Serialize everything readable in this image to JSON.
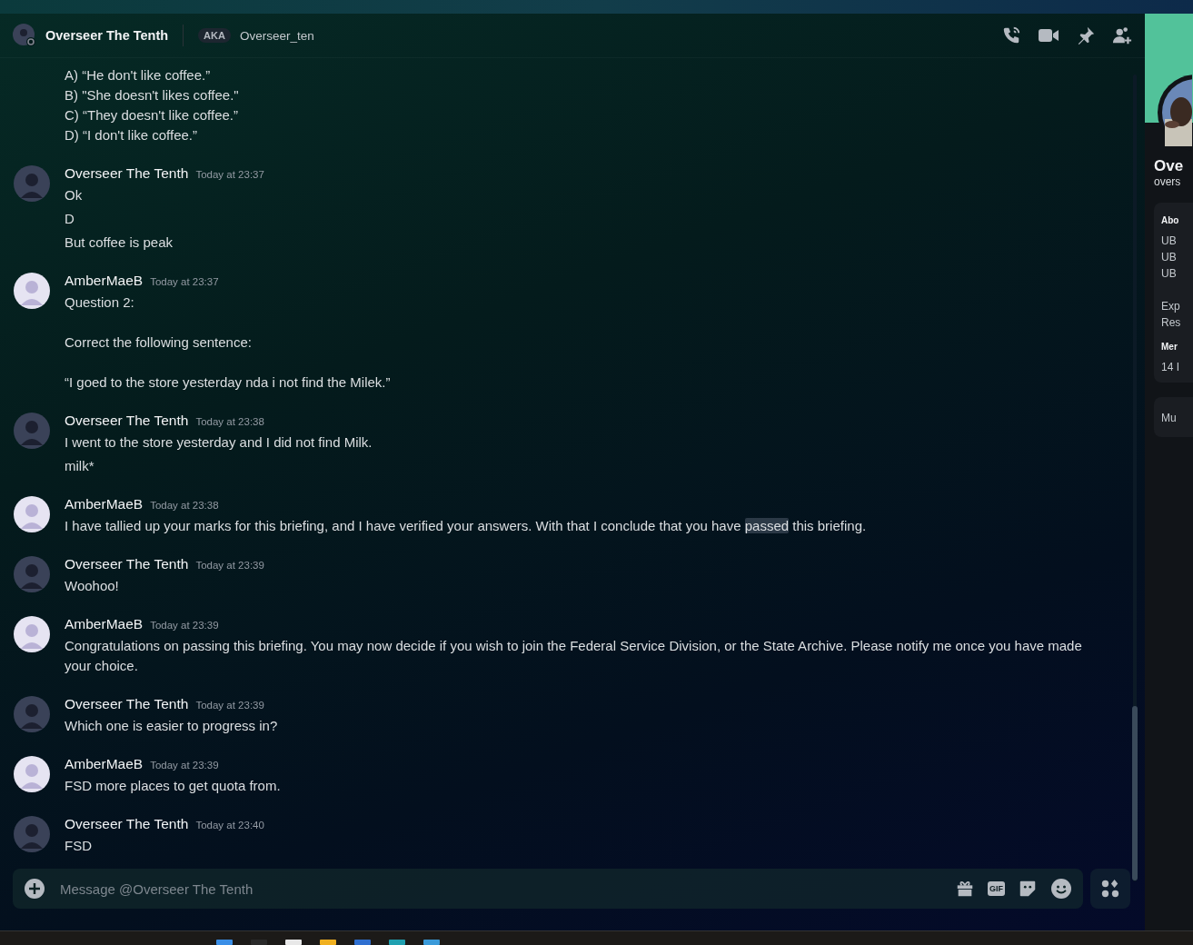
{
  "header": {
    "name": "Overseer The Tenth",
    "aka_badge": "AKA",
    "username": "Overseer_ten"
  },
  "messages": [
    {
      "continued": true,
      "lines": [
        [
          {
            "text": "A) “He don't like coffee.”\nB) \"She doesn't likes coffee.\"\nC) “They doesn't like coffee.”\nD) “I don't like coffee.”",
            "highlighted": false
          }
        ]
      ]
    },
    {
      "continued": false,
      "author": "Overseer The Tenth",
      "time": "Today at 23:37",
      "color": "#3a4258",
      "lines": [
        [
          {
            "text": "Ok",
            "highlighted": false
          }
        ],
        [
          {
            "text": "D",
            "highlighted": false
          }
        ],
        [
          {
            "text": "But coffee is peak",
            "highlighted": false
          }
        ]
      ]
    },
    {
      "continued": false,
      "author": "AmberMaeB",
      "time": "Today at 23:37",
      "color": "#e6e4f2",
      "lines": [
        [
          {
            "text": "Question 2:\n\nCorrect the following sentence:\n\n“I goed to the store yesterday nda i not find the Milek.”",
            "highlighted": false
          }
        ]
      ]
    },
    {
      "continued": false,
      "author": "Overseer The Tenth",
      "time": "Today at 23:38",
      "color": "#3a4258",
      "lines": [
        [
          {
            "text": "I went to the store yesterday and I did not find Milk.",
            "highlighted": false
          }
        ],
        [
          {
            "text": "milk*",
            "highlighted": false
          }
        ]
      ]
    },
    {
      "continued": false,
      "author": "AmberMaeB",
      "time": "Today at 23:38",
      "color": "#e6e4f2",
      "lines": [
        [
          {
            "text": "I have tallied up your marks for this briefing, and I have verified your answers. With that I conclude that you have ",
            "highlighted": false
          },
          {
            "text": "passed",
            "highlighted": true
          },
          {
            "text": " this briefing.",
            "highlighted": false
          }
        ]
      ]
    },
    {
      "continued": false,
      "author": "Overseer The Tenth",
      "time": "Today at 23:39",
      "color": "#3a4258",
      "lines": [
        [
          {
            "text": "Woohoo!",
            "highlighted": false
          }
        ]
      ]
    },
    {
      "continued": false,
      "author": "AmberMaeB",
      "time": "Today at 23:39",
      "color": "#e6e4f2",
      "lines": [
        [
          {
            "text": "Congratulations on passing this briefing. You may now decide if you wish to join the Federal Service Division, or the State Archive. Please notify me once you have made your choice.",
            "highlighted": false
          }
        ]
      ]
    },
    {
      "continued": false,
      "author": "Overseer The Tenth",
      "time": "Today at 23:39",
      "color": "#3a4258",
      "lines": [
        [
          {
            "text": "Which one is easier to progress in?",
            "highlighted": false
          }
        ]
      ]
    },
    {
      "continued": false,
      "author": "AmberMaeB",
      "time": "Today at 23:39",
      "color": "#e6e4f2",
      "lines": [
        [
          {
            "text": "FSD more places to get quota from.",
            "highlighted": false
          }
        ]
      ]
    },
    {
      "continued": false,
      "author": "Overseer The Tenth",
      "time": "Today at 23:40",
      "color": "#3a4258",
      "lines": [
        [
          {
            "text": "FSD",
            "highlighted": false
          }
        ]
      ]
    }
  ],
  "composer": {
    "placeholder": "Message @Overseer The Tenth",
    "gif_label": "GIF"
  },
  "profile": {
    "name": "Ove",
    "handle": "overs",
    "about_title": "Abo",
    "about_lines": [
      "UB",
      "UB",
      "UB"
    ],
    "about_lines_2": [
      "Exp",
      "Res"
    ],
    "member_title": "Mer",
    "member_since": "14 I",
    "mutual": "Mu"
  }
}
